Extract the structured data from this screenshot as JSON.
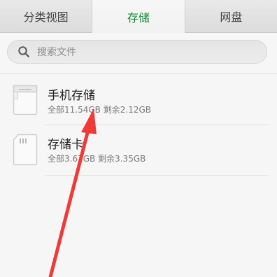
{
  "tabs": [
    {
      "label": "分类视图",
      "active": false
    },
    {
      "label": "存储",
      "active": true
    },
    {
      "label": "网盘",
      "active": false
    }
  ],
  "search": {
    "placeholder": "搜索文件"
  },
  "storage": [
    {
      "title": "手机存储",
      "total_label": "全部",
      "total": "11.54GB",
      "free_label": "剩余",
      "free": "2.12GB"
    },
    {
      "title": "存储卡",
      "total_label": "全部",
      "total": "3.67GB",
      "free_label": "剩余",
      "free": "3.35GB"
    }
  ],
  "colors": {
    "accent": "#1b8a3a",
    "annotation_arrow": "#ef3a3a"
  }
}
